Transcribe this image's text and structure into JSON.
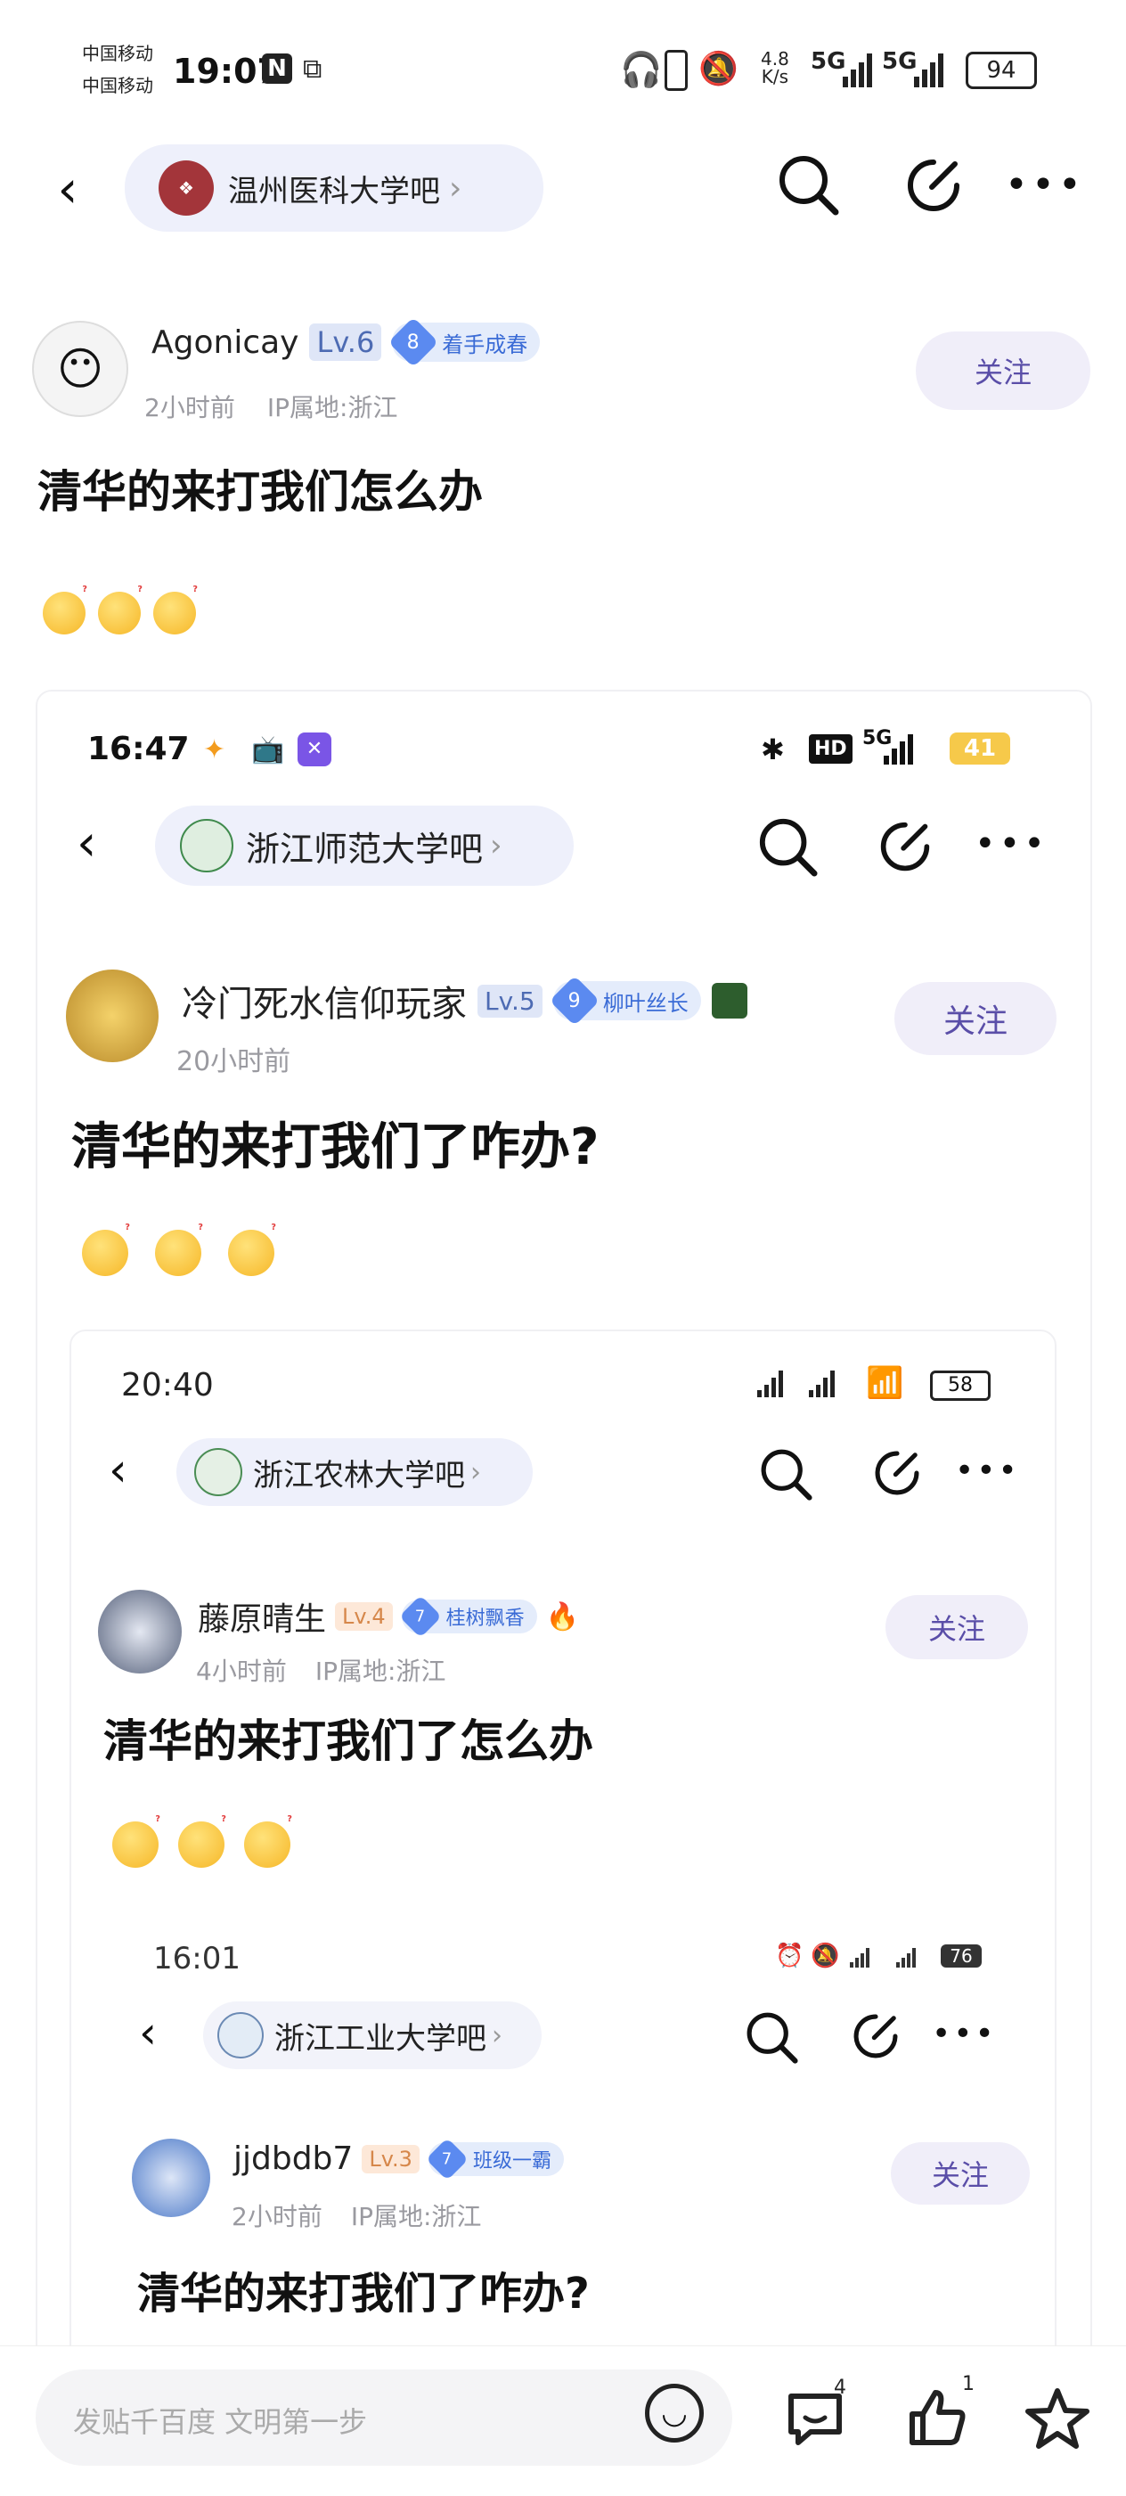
{
  "status_bar": {
    "carrier1": "中国移动",
    "carrier2": "中国移动",
    "time": "19:07",
    "net_speed_value": "4.8",
    "net_speed_unit": "K/s",
    "net1": "5G",
    "net2": "5G",
    "battery": "94"
  },
  "header": {
    "forum_name": "温州医科大学吧"
  },
  "post": {
    "author": "Agonicay",
    "level": "Lv.6",
    "tag_num": "8",
    "tag_label": "着手成春",
    "time_ago": "2小时前",
    "ip": "IP属地:浙江",
    "follow_label": "关注",
    "title": "清华的来打我们怎么办"
  },
  "shot1": {
    "time": "16:47",
    "hd": "HD",
    "net": "5G",
    "battery": "41",
    "forum_name": "浙江师范大学吧",
    "author": "冷门死水信仰玩家",
    "level": "Lv.5",
    "tag_num": "9",
    "tag_label": "柳叶丝长",
    "time_ago": "20小时前",
    "follow_label": "关注",
    "title": "清华的来打我们了咋办?"
  },
  "shot2": {
    "time": "20:40",
    "battery": "58",
    "forum_name": "浙江农林大学吧",
    "author": "藤原晴生",
    "level": "Lv.4",
    "tag_num": "7",
    "tag_label": "桂树飘香",
    "time_ago": "4小时前",
    "ip": "IP属地:浙江",
    "follow_label": "关注",
    "title": "清华的来打我们了怎么办"
  },
  "shot3": {
    "time": "16:01",
    "battery": "76",
    "forum_name": "浙江工业大学吧",
    "author": "jjdbdb7",
    "level": "Lv.3",
    "tag_num": "7",
    "tag_label": "班级一霸",
    "time_ago": "2小时前",
    "ip": "IP属地:浙江",
    "follow_label": "关注",
    "title": "清华的来打我们了咋办?"
  },
  "bottom": {
    "input_placeholder": "发贴千百度 文明第一步",
    "comment_count": "4",
    "like_count": "1"
  },
  "colors": {
    "accent": "#5a4ea8",
    "pill_bg": "#eef0fb",
    "tag_blue": "#3a6bd6"
  }
}
